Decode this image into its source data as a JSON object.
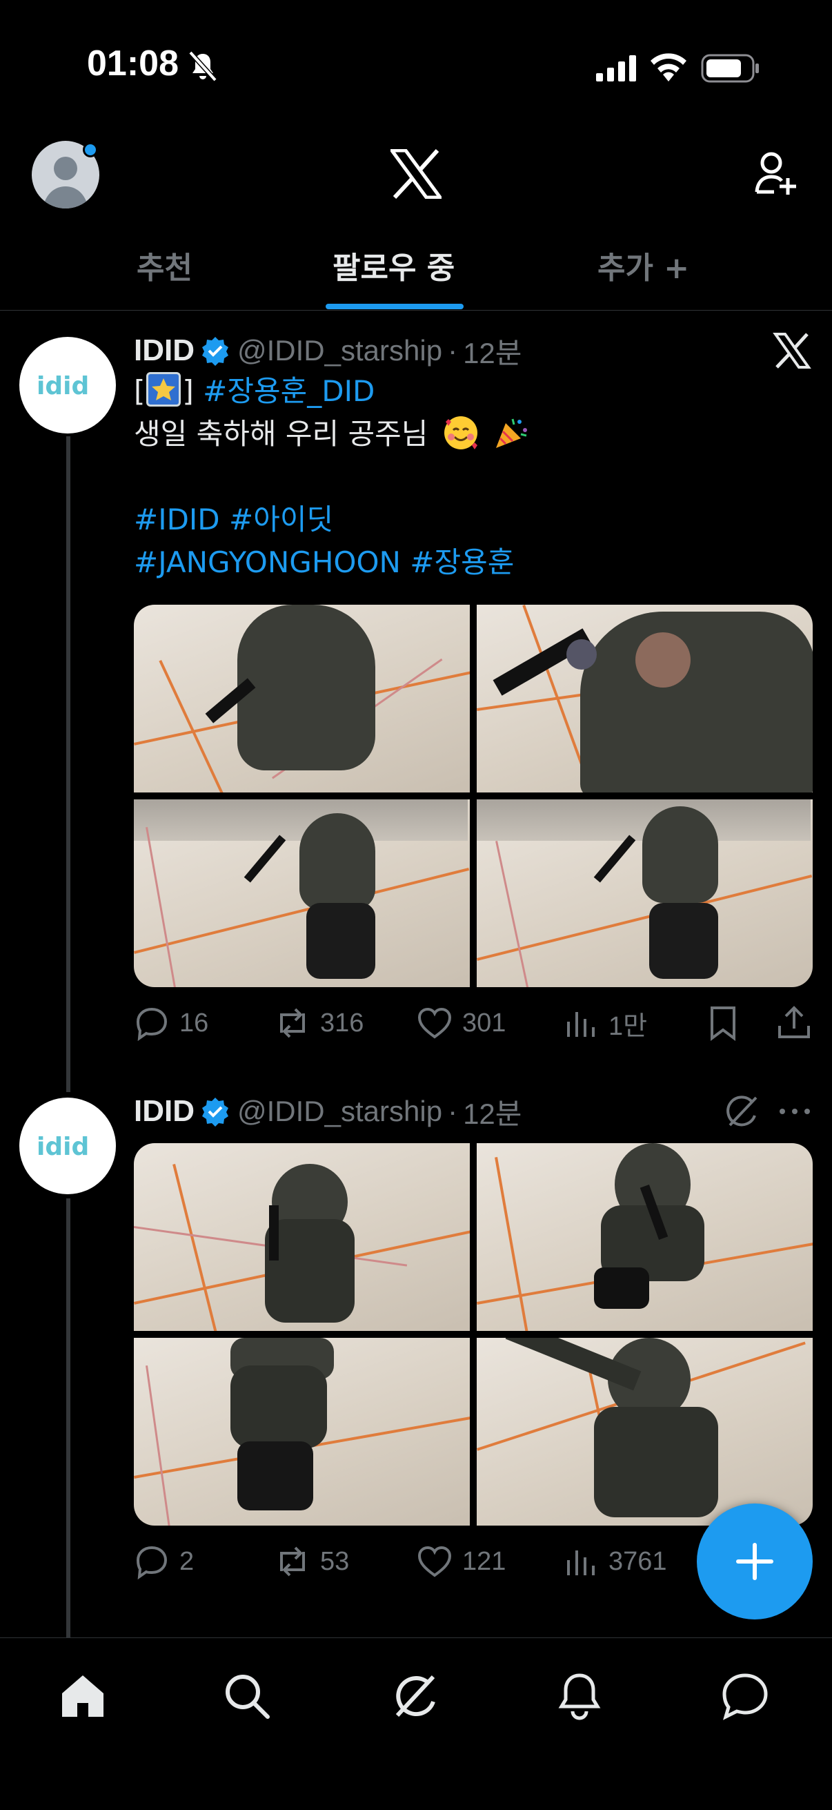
{
  "status_bar": {
    "time": "01:08"
  },
  "header": {
    "tabs": [
      {
        "label": "추천"
      },
      {
        "label": "팔로우 중"
      },
      {
        "label": "추가 +"
      }
    ]
  },
  "tweets": [
    {
      "name": "IDID",
      "handle": "@IDID_starship",
      "time": "12분",
      "text_lines": [
        {
          "prefix": "[",
          "suffix": "] ",
          "hashtag": "#장용훈_DID"
        },
        {
          "text": "생일 축하해 우리 공주님"
        },
        {
          "text": ""
        },
        {
          "hashtags": "#IDID #아이딧"
        },
        {
          "hashtags": "#JANGYONGHOON #장용훈"
        }
      ],
      "replies": "16",
      "reposts": "316",
      "likes": "301",
      "views": "1만"
    },
    {
      "name": "IDID",
      "handle": "@IDID_starship",
      "time": "12분",
      "replies": "2",
      "reposts": "53",
      "likes": "121",
      "views": "3761"
    }
  ],
  "colors": {
    "accent": "#1d9bf0",
    "muted": "#71767b",
    "background": "#000000"
  }
}
